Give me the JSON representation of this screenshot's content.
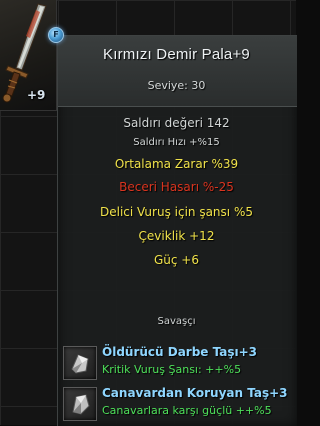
{
  "item": {
    "plus_badge": "+9",
    "gem_letter": "F",
    "title": "Kırmızı Demir Pala+9",
    "level": "Seviye: 30",
    "sale_price": "Saldırı değeri 142",
    "attack_speed": "Saldırı Hızı +%15"
  },
  "bonuses": {
    "avg_damage": "Ortalama Zarar %39",
    "skill_damage": "Beceri Hasarı %-25",
    "crit_chance": "Delici Vuruş için şansı %5",
    "agility": "Çeviklik +12",
    "strength": "Güç +6"
  },
  "class_label": "Savaşçı",
  "stones": [
    {
      "name": "Öldürücü Darbe Taşı+3",
      "effect": "Kritik Vuruş Şansı: ++%5",
      "icon": "stone-icon"
    },
    {
      "name": "Canavardan Koruyan Taş+3",
      "effect": "Canavarlara karşı güçlü ++%5",
      "icon": "stone-icon"
    }
  ],
  "colors": {
    "title": "#eef2f4",
    "bonus_yellow": "#f0e24a",
    "penalty_red": "#d8341f",
    "stone_name_blue": "#8fd6ff",
    "stone_effect_green": "#4ee05a"
  }
}
